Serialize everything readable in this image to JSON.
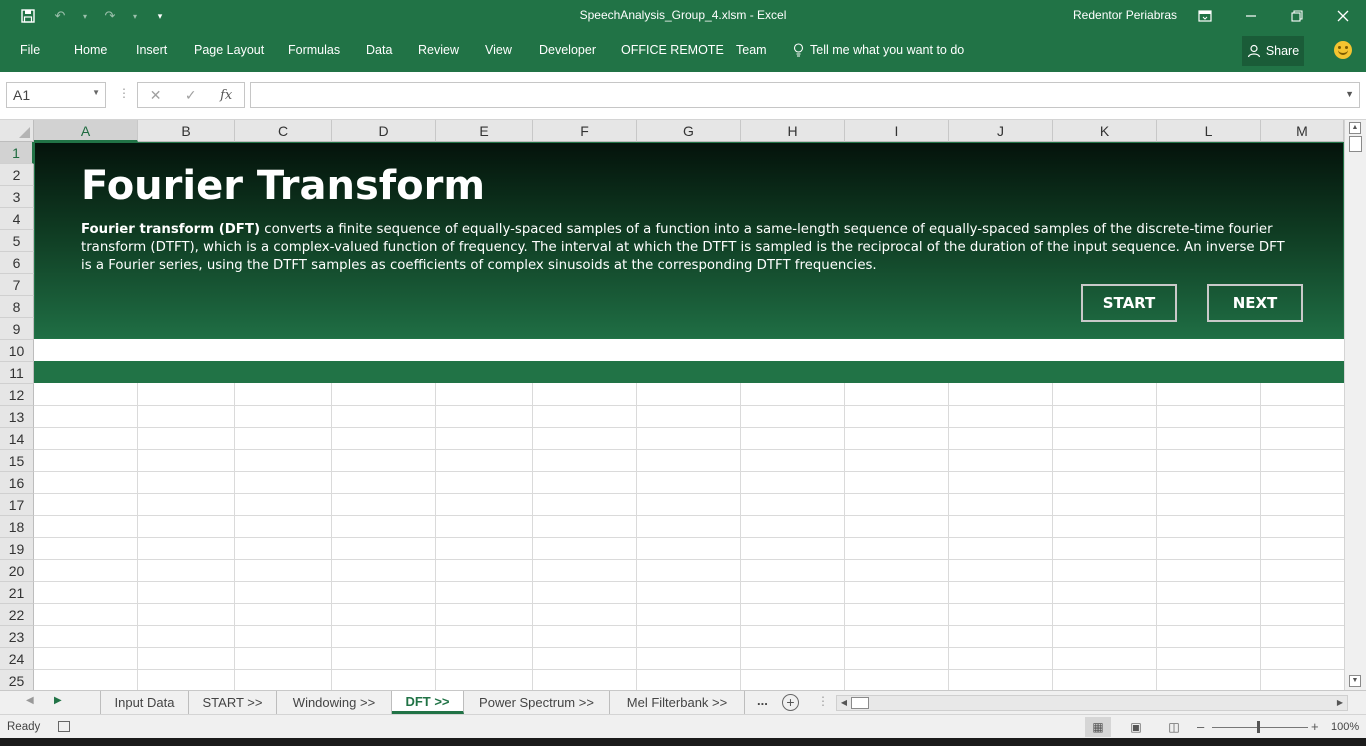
{
  "window": {
    "title": "SpeechAnalysis_Group_4.xlsm  -  Excel",
    "user": "Redentor Periabras"
  },
  "ribbon": {
    "tabs": [
      "File",
      "Home",
      "Insert",
      "Page Layout",
      "Formulas",
      "Data",
      "Review",
      "View",
      "Developer",
      "OFFICE REMOTE",
      "Team"
    ],
    "tell_me": "Tell me what you want to do",
    "share": "Share"
  },
  "formula_bar": {
    "name_box": "A1",
    "fx": "fx",
    "formula": ""
  },
  "grid": {
    "columns": [
      "A",
      "B",
      "C",
      "D",
      "E",
      "F",
      "G",
      "H",
      "I",
      "J",
      "K",
      "L",
      "M"
    ],
    "rows": [
      "1",
      "2",
      "3",
      "4",
      "5",
      "6",
      "7",
      "8",
      "9",
      "10",
      "11",
      "12",
      "13",
      "14",
      "15",
      "16",
      "17",
      "18",
      "19",
      "20",
      "21",
      "22",
      "23",
      "24",
      "25"
    ],
    "selected_cell": "A1"
  },
  "banner": {
    "title": "Fourier Transform",
    "description_bold": "Fourier transform (DFT)",
    "description": " converts a finite sequence of equally-spaced samples of a function into a same-length sequence of equally-spaced samples of the discrete-time fourier transform (DTFT), which is a complex-valued function of frequency. The interval at which the DTFT is sampled is the reciprocal of the duration of the input sequence. An inverse DFT is a Fourier series, using the DTFT samples as coefficients of complex sinusoids at the corresponding DTFT frequencies.",
    "start_label": "START",
    "next_label": "NEXT",
    "gradient_top": "#04130b",
    "gradient_bottom": "#1f6e44"
  },
  "sheet_tabs": {
    "tabs": [
      "Input Data",
      "START >>",
      "Windowing >>",
      "DFT >>",
      "Power Spectrum >>",
      "Mel Filterbank >>"
    ],
    "active": "DFT >>",
    "more": "..."
  },
  "status_bar": {
    "status": "Ready",
    "zoom": "100%"
  },
  "colors": {
    "excel_green": "#217346",
    "share_bg": "#1a5c38"
  }
}
